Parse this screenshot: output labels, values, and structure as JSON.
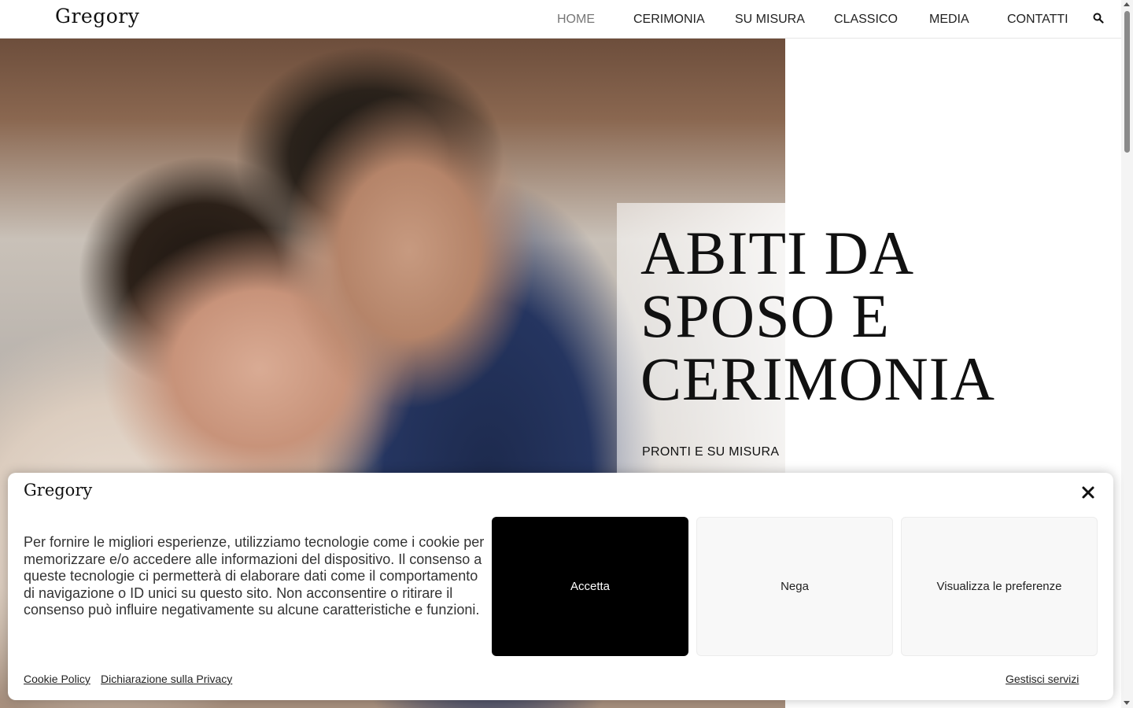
{
  "header": {
    "logo": "Gregory",
    "nav": [
      "HOME",
      "CERIMONIA",
      "SU MISURA",
      "CLASSICO",
      "MEDIA",
      "CONTATTI"
    ],
    "search_icon": "search-icon"
  },
  "hero": {
    "title_lines": [
      "ABITI DA",
      "SPOSO E",
      "CERIMONIA"
    ],
    "subtitle": "PRONTI E SU MISURA"
  },
  "cookie_banner": {
    "logo": "Gregory",
    "close_icon": "close-icon",
    "text": "Per fornire le migliori esperienze, utilizziamo tecnologie come i cookie per memorizzare e/o accedere alle informazioni del dispositivo. Il consenso a queste tecnologie ci permetterà di elaborare dati come il comportamento di navigazione o ID unici su questo sito. Non acconsentire o ritirare il consenso può influire negativamente su alcune caratteristiche e funzioni.",
    "buttons": {
      "accept": "Accetta",
      "deny": "Nega",
      "preferences": "Visualizza le preferenze"
    },
    "links": {
      "cookie_policy": "Cookie Policy",
      "privacy": "Dichiarazione sulla Privacy",
      "manage": "Gestisci servizi"
    }
  },
  "colors": {
    "accent": "#000000",
    "nav_active": "#777777",
    "button_light": "#f8f8f8"
  }
}
